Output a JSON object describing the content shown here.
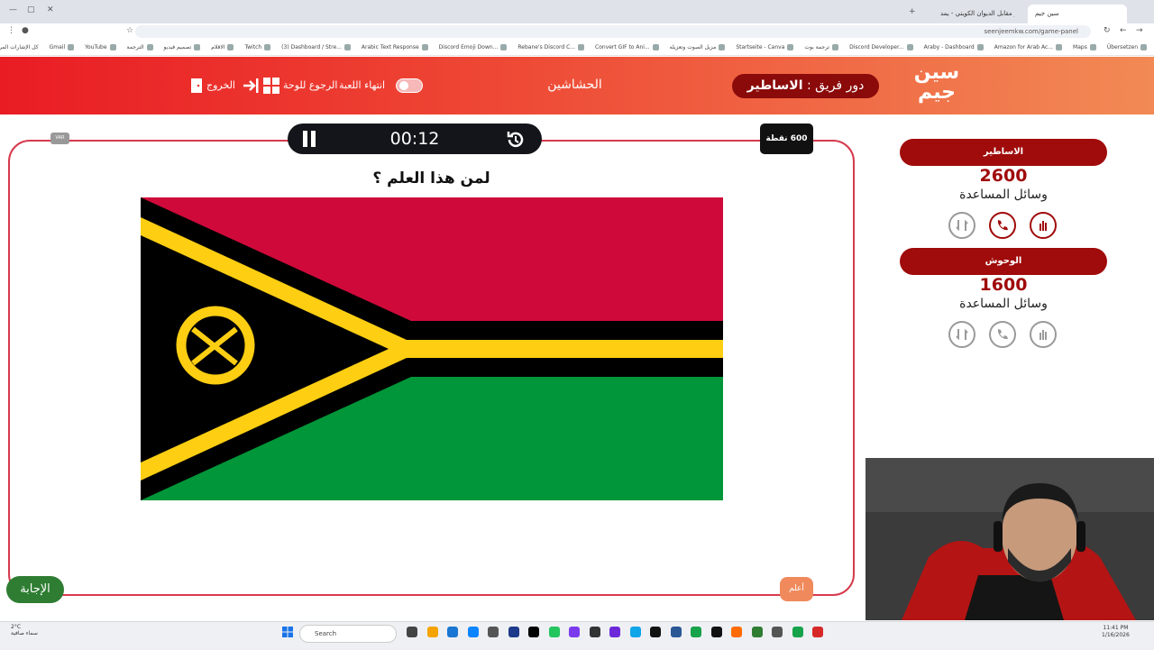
{
  "browser": {
    "tabs": [
      {
        "label": "سين جيم"
      },
      {
        "label": "الاليوبو مقابل الديوان الكويتي - يمد..."
      }
    ],
    "url": "seenjeemkw.com/game-panel",
    "bookmarks": [
      "Übersetzen",
      "Maps",
      "Amazon for Arab Ac...",
      "Araby - Dashboard",
      "Discord Developer...",
      "ترجمة بوت",
      "Startseite - Canva",
      "مزيل الصوت وتعزيله",
      "Convert GIF to Ani...",
      "Rebane's Discord C...",
      "Discord Emoji Down...",
      "Arabic Text Response",
      "(3) Dashboard / Stre...",
      "Twitch",
      "الاقلام",
      "تصميم فيديو",
      "الترجمة",
      "YouTube",
      "Gmail"
    ],
    "bookmarks_left": "كل الإشارات المرجعية"
  },
  "header": {
    "logo_line1": "سين",
    "logo_line2": "جيم",
    "turn_prefix": "دور فريق :",
    "turn_team": "الاساطير",
    "center_label": "الحشاشين",
    "end_game": "انتهاء اللعبة",
    "back_board": "الرجوع للوحة",
    "exit": "الخروج"
  },
  "game": {
    "timer": "00:12",
    "points": "600 نقطة",
    "var_label": "VAR",
    "question": "لمن هذا العلم ؟",
    "answer_button": "الإجابة",
    "know_button": "أعلم",
    "flag_colors": {
      "red": "#cf0a3b",
      "black": "#000000",
      "yellow": "#fdce12",
      "green": "#009639"
    }
  },
  "teams": [
    {
      "name": "الاساطير",
      "score": "2600",
      "help_label": "وسائل المساعدة",
      "helps": [
        "hand-icon",
        "phone-icon",
        "swap-icon"
      ],
      "active_helps": [
        true,
        true,
        false
      ]
    },
    {
      "name": "الوحوش",
      "score": "1600",
      "help_label": "وسائل المساعدة",
      "helps": [
        "hand-icon",
        "phone-icon",
        "swap-icon"
      ],
      "active_helps": [
        false,
        false,
        false
      ]
    }
  ],
  "taskbar": {
    "search_placeholder": "Search",
    "weather_temp": "2°C",
    "weather_text": "سماء صافية",
    "time": "11:41 PM",
    "date": "1/16/2026"
  },
  "colors": {
    "accent": "#e91c24",
    "team_bar": "#a00b0b",
    "panel_border": "#d63a4d",
    "answer_green": "#2e7d32"
  }
}
